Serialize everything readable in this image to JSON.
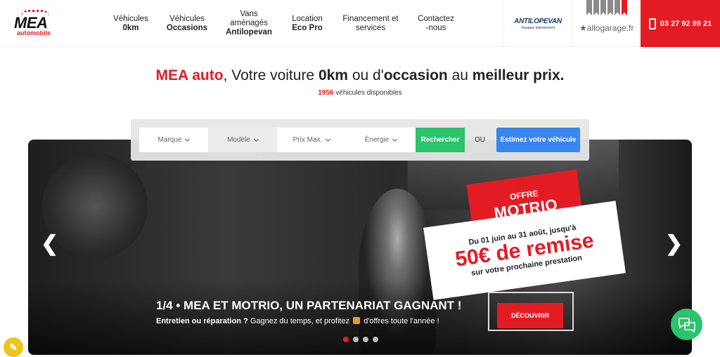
{
  "header": {
    "logo": {
      "name": "MEA",
      "sub": "automobile"
    },
    "nav": [
      {
        "line1": "Véhicules",
        "line2": "",
        "line3": "0km"
      },
      {
        "line1": "Véhicules",
        "line2": "",
        "line3": "Occasions"
      },
      {
        "line1": "Vans",
        "line2": "aménagés",
        "line3": "Antilopevan"
      },
      {
        "line1": "Location",
        "line2": "",
        "line3": "Eco Pro"
      },
      {
        "line1": "Financement et",
        "line2": "services",
        "line3": ""
      },
      {
        "line1": "Contactez",
        "line2": "-nous",
        "line3": ""
      }
    ],
    "partner1": {
      "brand": "ANTILOPEVAN",
      "tagline": "Voyagez Intensément"
    },
    "partner2": {
      "brand": "allogarage.fr"
    },
    "phone": "03 27 92 99 21"
  },
  "headline": {
    "brand": "MEA auto",
    "part1": ", Votre voiture ",
    "bold1": "0km",
    "part2": " ou d'",
    "bold2": "occasion",
    "part3": " au ",
    "bold3": "meilleur prix."
  },
  "count": {
    "number": "1956",
    "label": " véhicules disponibles"
  },
  "search": {
    "fields": [
      "Marque",
      "Modèle",
      "Prix Max.",
      "Énergie"
    ],
    "search_button": "Rechercher",
    "or_label": "OU",
    "estimate_button": "Estimez votre véhicule"
  },
  "hero": {
    "offer_tag1": "OFFRE",
    "offer_tag2": "MOTRIO",
    "offer_line1": "Du 01 juin au 31 août, jusqu'à",
    "offer_line2": "50€ de remise",
    "offer_line3": "sur votre prochaine prestation",
    "title": "1/4 • MEA ET MOTRIO, UN PARTENARIAT GAGNANT !",
    "subtitle_bold": "Entretien ou réparation ?",
    "subtitle_rest1": " Gagnez du temps, et profitez ",
    "subtitle_rest2": " d'offres toute l'année !",
    "cta": "DÉCOUVRIR",
    "slides_total": 4,
    "slide_active": 1
  },
  "colors": {
    "brand_red": "#e31b23",
    "search_green": "#2bc36b",
    "estimate_blue": "#3a86ef"
  },
  "icons": [
    "phone-icon",
    "chevron-down-icon",
    "arrow-left-icon",
    "arrow-right-icon",
    "gift-icon",
    "chat-icon",
    "accessibility-icon"
  ]
}
